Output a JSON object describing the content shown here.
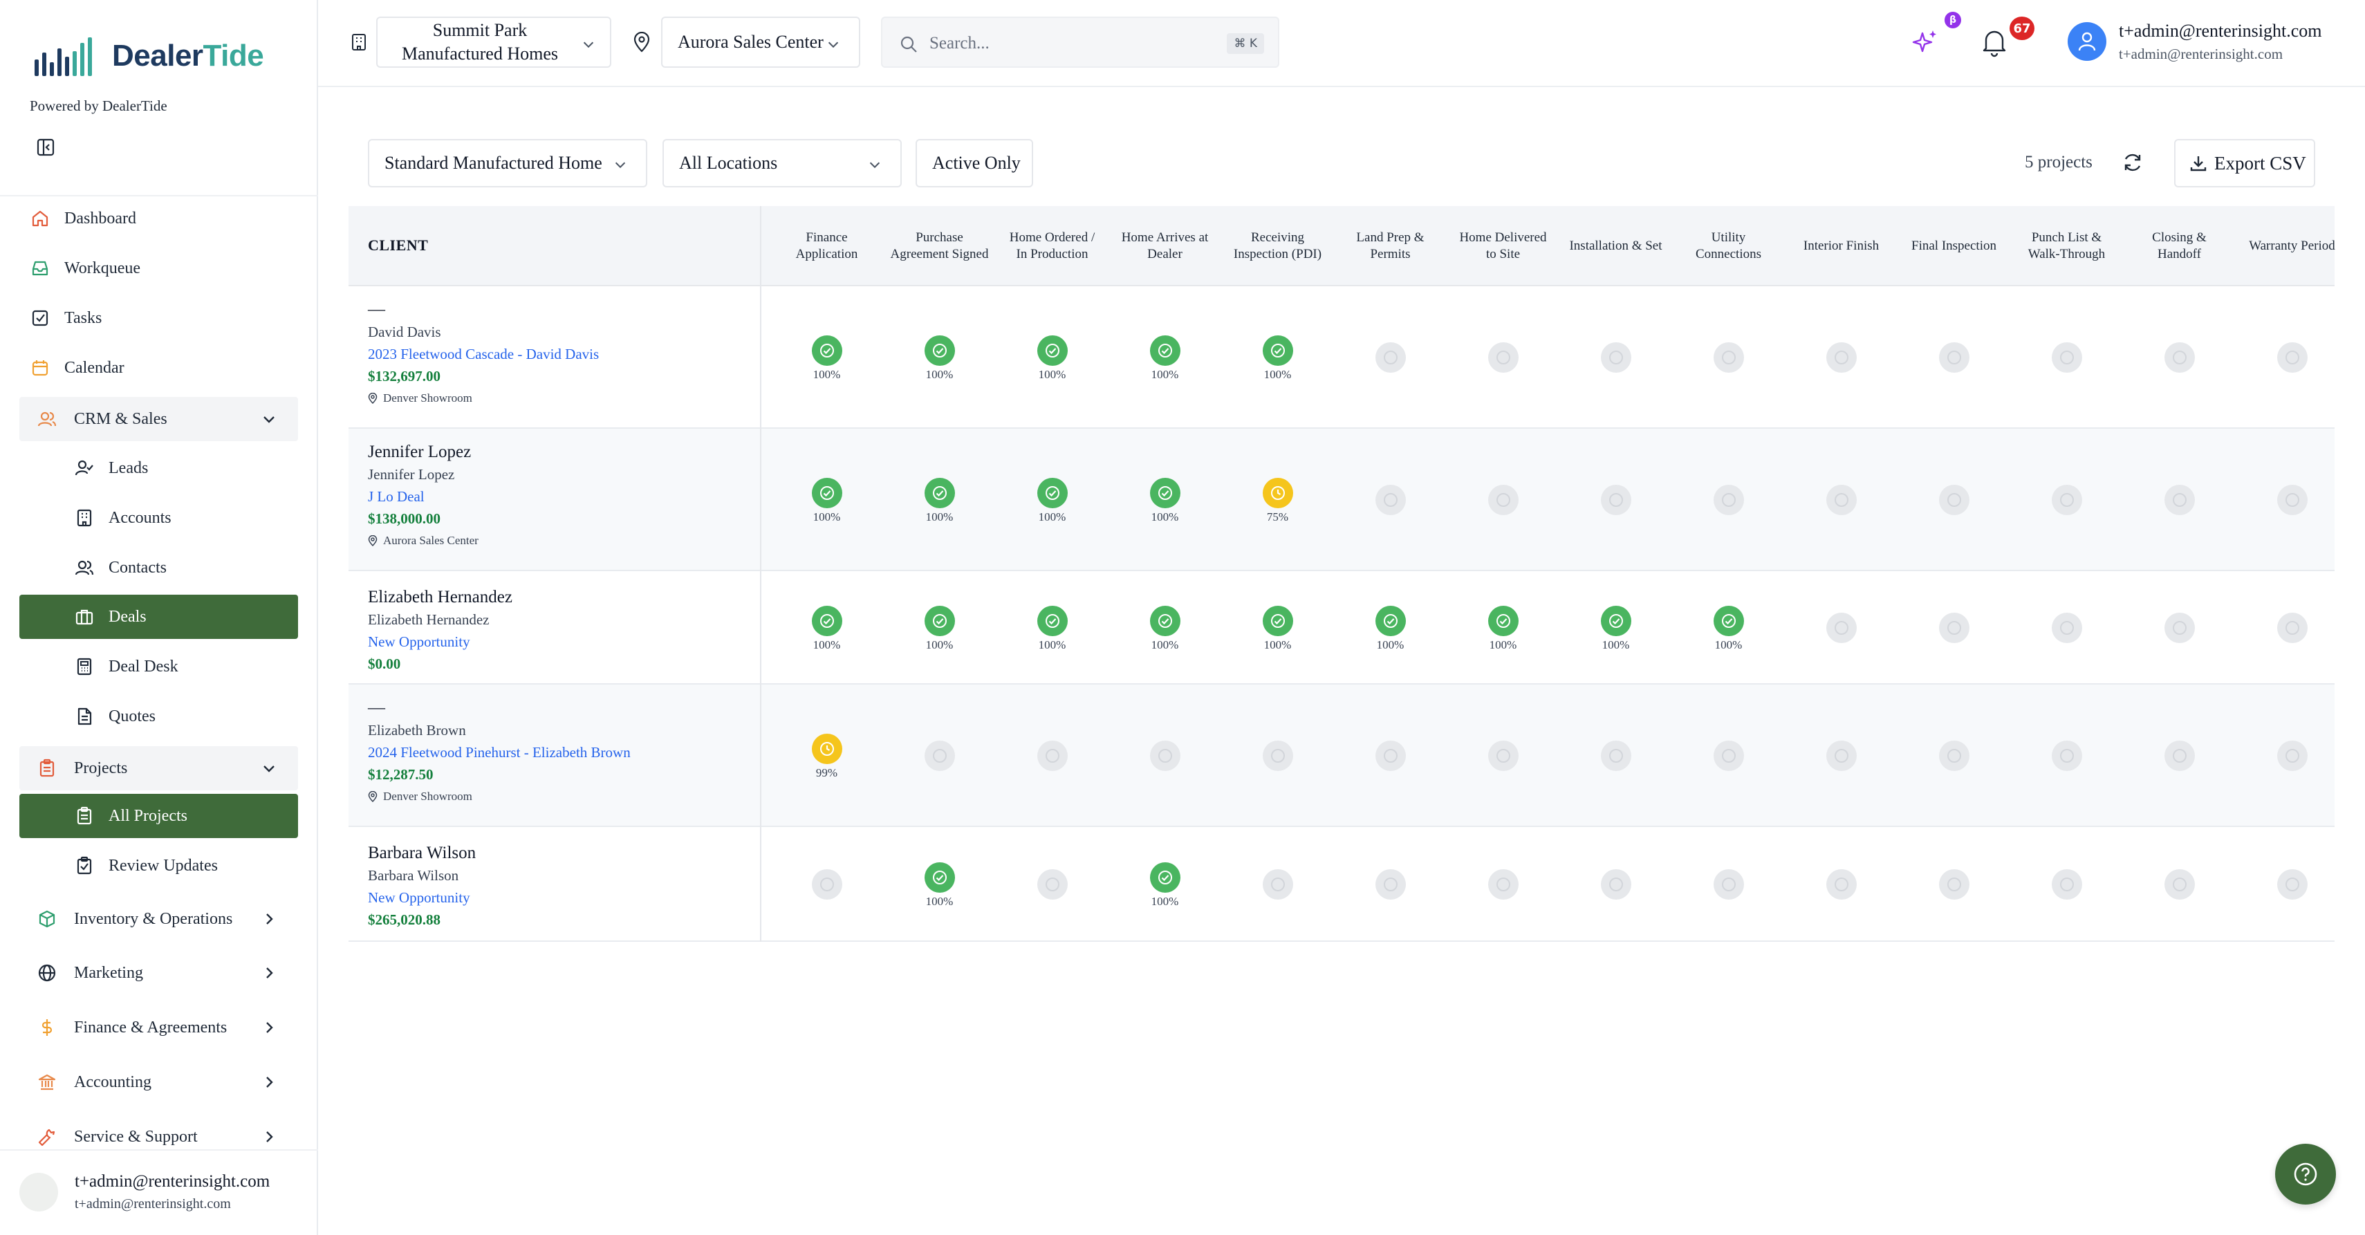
{
  "brand": {
    "logo_text_a": "Dealer",
    "logo_text_b": "Tide",
    "powered_by": "Powered by DealerTide",
    "colors": {
      "primary_green": "#3f6b3a",
      "brand_navy": "#1e3a5f",
      "brand_teal": "#3aa89a"
    }
  },
  "sidebar": {
    "items": [
      {
        "label": "Dashboard",
        "icon": "home-icon"
      },
      {
        "label": "Workqueue",
        "icon": "inbox-icon"
      },
      {
        "label": "Tasks",
        "icon": "checkbox-icon"
      },
      {
        "label": "Calendar",
        "icon": "calendar-icon"
      },
      {
        "label": "CRM & Sales",
        "icon": "users-icon"
      },
      {
        "label": "Leads",
        "icon": "user-check-icon"
      },
      {
        "label": "Accounts",
        "icon": "building-icon"
      },
      {
        "label": "Contacts",
        "icon": "users-icon"
      },
      {
        "label": "Deals",
        "icon": "briefcase-icon"
      },
      {
        "label": "Deal Desk",
        "icon": "calculator-icon"
      },
      {
        "label": "Quotes",
        "icon": "file-icon"
      },
      {
        "label": "Projects",
        "icon": "clipboard-icon"
      },
      {
        "label": "All Projects",
        "icon": "clipboard-icon"
      },
      {
        "label": "Review Updates",
        "icon": "clipboard-check-icon"
      },
      {
        "label": "Inventory & Operations",
        "icon": "package-icon"
      },
      {
        "label": "Marketing",
        "icon": "globe-icon"
      },
      {
        "label": "Finance & Agreements",
        "icon": "dollar-icon"
      },
      {
        "label": "Accounting",
        "icon": "bank-icon"
      },
      {
        "label": "Service & Support",
        "icon": "wrench-icon"
      }
    ],
    "user": {
      "name": "t+admin@renterinsight.com",
      "email": "t+admin@renterinsight.com"
    }
  },
  "topbar": {
    "org": "Summit Park Manufactured Homes",
    "location": "Aurora Sales Center",
    "search_placeholder": "Search...",
    "search_shortcut": "⌘ K",
    "ai_badge": "β",
    "notifications": "67",
    "user_name": "t+admin@renterinsight.com",
    "user_email": "t+admin@renterinsight.com"
  },
  "filters": {
    "type": "Standard Manufactured Home",
    "location": "All Locations",
    "active": "Active Only",
    "project_count": "5 projects",
    "export_label": "Export CSV"
  },
  "table": {
    "client_header": "CLIENT",
    "stages": [
      "Finance Application",
      "Purchase Agreement Signed",
      "Home Ordered / In Production",
      "Home Arrives at Dealer",
      "Receiving Inspection (PDI)",
      "Land Prep & Permits",
      "Home Delivered to Site",
      "Installation & Set",
      "Utility Connections",
      "Interior Finish",
      "Final Inspection",
      "Punch List & Walk-Through",
      "Closing & Handoff",
      "Warranty Period"
    ],
    "rows": [
      {
        "name": "—",
        "contact": "David Davis",
        "deal": "2023 Fleetwood Cascade - David Davis",
        "amount": "$132,697.00",
        "location": "Denver Showroom",
        "stages": [
          {
            "s": "done",
            "p": "100%"
          },
          {
            "s": "done",
            "p": "100%"
          },
          {
            "s": "done",
            "p": "100%"
          },
          {
            "s": "done",
            "p": "100%"
          },
          {
            "s": "done",
            "p": "100%"
          },
          {
            "s": "none",
            "p": ""
          },
          {
            "s": "none",
            "p": ""
          },
          {
            "s": "none",
            "p": ""
          },
          {
            "s": "none",
            "p": ""
          },
          {
            "s": "none",
            "p": ""
          },
          {
            "s": "none",
            "p": ""
          },
          {
            "s": "none",
            "p": ""
          },
          {
            "s": "none",
            "p": ""
          },
          {
            "s": "none",
            "p": ""
          }
        ]
      },
      {
        "name": "Jennifer Lopez",
        "contact": "Jennifer Lopez",
        "deal": "J Lo Deal",
        "amount": "$138,000.00",
        "location": "Aurora Sales Center",
        "stages": [
          {
            "s": "done",
            "p": "100%"
          },
          {
            "s": "done",
            "p": "100%"
          },
          {
            "s": "done",
            "p": "100%"
          },
          {
            "s": "done",
            "p": "100%"
          },
          {
            "s": "prog",
            "p": "75%"
          },
          {
            "s": "none",
            "p": ""
          },
          {
            "s": "none",
            "p": ""
          },
          {
            "s": "none",
            "p": ""
          },
          {
            "s": "none",
            "p": ""
          },
          {
            "s": "none",
            "p": ""
          },
          {
            "s": "none",
            "p": ""
          },
          {
            "s": "none",
            "p": ""
          },
          {
            "s": "none",
            "p": ""
          },
          {
            "s": "none",
            "p": ""
          }
        ]
      },
      {
        "name": "Elizabeth Hernandez",
        "contact": "Elizabeth Hernandez",
        "deal": "New Opportunity",
        "amount": "$0.00",
        "location": "",
        "stages": [
          {
            "s": "done",
            "p": "100%"
          },
          {
            "s": "done",
            "p": "100%"
          },
          {
            "s": "done",
            "p": "100%"
          },
          {
            "s": "done",
            "p": "100%"
          },
          {
            "s": "done",
            "p": "100%"
          },
          {
            "s": "done",
            "p": "100%"
          },
          {
            "s": "done",
            "p": "100%"
          },
          {
            "s": "done",
            "p": "100%"
          },
          {
            "s": "done",
            "p": "100%"
          },
          {
            "s": "none",
            "p": ""
          },
          {
            "s": "none",
            "p": ""
          },
          {
            "s": "none",
            "p": ""
          },
          {
            "s": "none",
            "p": ""
          },
          {
            "s": "none",
            "p": ""
          }
        ]
      },
      {
        "name": "—",
        "contact": "Elizabeth Brown",
        "deal": "2024 Fleetwood Pinehurst - Elizabeth Brown",
        "amount": "$12,287.50",
        "location": "Denver Showroom",
        "stages": [
          {
            "s": "prog",
            "p": "99%"
          },
          {
            "s": "none",
            "p": ""
          },
          {
            "s": "none",
            "p": ""
          },
          {
            "s": "none",
            "p": ""
          },
          {
            "s": "none",
            "p": ""
          },
          {
            "s": "none",
            "p": ""
          },
          {
            "s": "none",
            "p": ""
          },
          {
            "s": "none",
            "p": ""
          },
          {
            "s": "none",
            "p": ""
          },
          {
            "s": "none",
            "p": ""
          },
          {
            "s": "none",
            "p": ""
          },
          {
            "s": "none",
            "p": ""
          },
          {
            "s": "none",
            "p": ""
          },
          {
            "s": "none",
            "p": ""
          }
        ]
      },
      {
        "name": "Barbara Wilson",
        "contact": "Barbara Wilson",
        "deal": "New Opportunity",
        "amount": "$265,020.88",
        "location": "",
        "stages": [
          {
            "s": "none",
            "p": ""
          },
          {
            "s": "done",
            "p": "100%"
          },
          {
            "s": "none",
            "p": ""
          },
          {
            "s": "done",
            "p": "100%"
          },
          {
            "s": "none",
            "p": ""
          },
          {
            "s": "none",
            "p": ""
          },
          {
            "s": "none",
            "p": ""
          },
          {
            "s": "none",
            "p": ""
          },
          {
            "s": "none",
            "p": ""
          },
          {
            "s": "none",
            "p": ""
          },
          {
            "s": "none",
            "p": ""
          },
          {
            "s": "none",
            "p": ""
          },
          {
            "s": "none",
            "p": ""
          },
          {
            "s": "none",
            "p": ""
          }
        ]
      }
    ]
  }
}
